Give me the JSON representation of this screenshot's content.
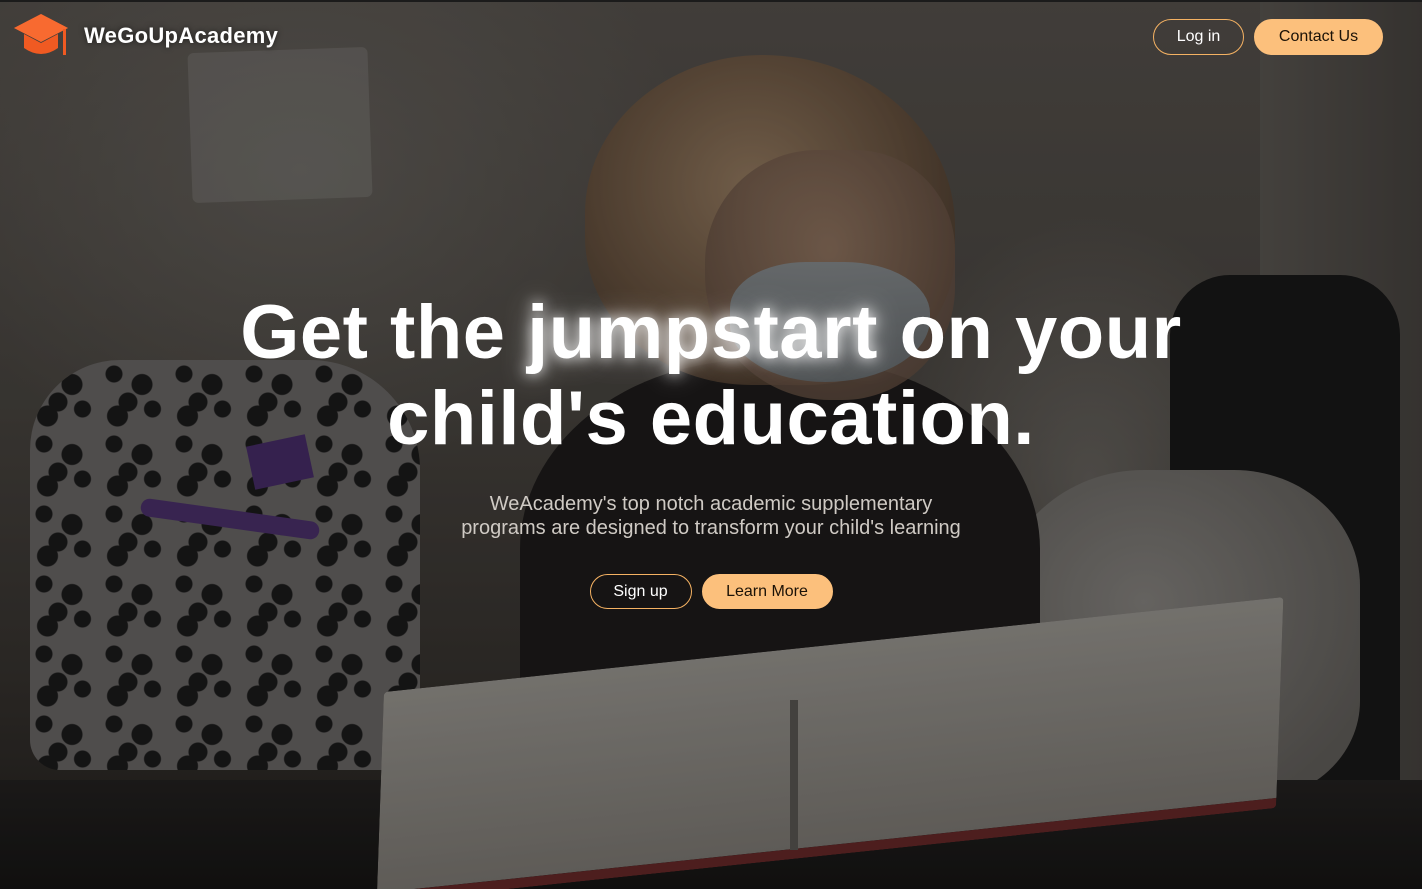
{
  "brand": {
    "name": "WeGoUpAcademy",
    "logo_icon": "graduation-cap-icon",
    "logo_color": "#f05a22"
  },
  "nav": {
    "login_label": "Log in",
    "contact_label": "Contact Us"
  },
  "hero": {
    "headline_part1": "Get the ",
    "headline_highlight": "jumpstart",
    "headline_part2": " on your",
    "headline_line2": "child's education.",
    "subtitle_line1": "WeAcademy's top notch academic supplementary",
    "subtitle_line2": "programs are designed to transform your child's learning",
    "signup_label": "Sign up",
    "learn_more_label": "Learn More"
  },
  "colors": {
    "accent": "#fcc07c",
    "accent_border": "#f5b263",
    "text": "#ffffff"
  }
}
